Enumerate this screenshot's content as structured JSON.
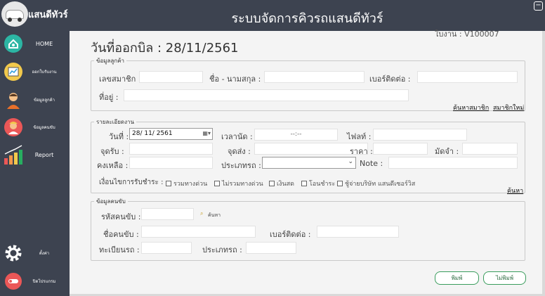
{
  "brand": {
    "name": "แสนดีทัวร์"
  },
  "nav": {
    "home": "HOME",
    "billing": "ออกใบรับงาน",
    "customer": "ข้อมูลลูกค้า",
    "driver": "ข้อมูลคนขับ",
    "report": "Report",
    "settings": "ตั้งค่า",
    "exit": "ปิดโปรแกรม"
  },
  "header": {
    "title": "ระบบจัดการคิวรถแสนดีทัวร์",
    "minimize": "−"
  },
  "page": {
    "bill_date_label": "วันที่ออกบิล : 28/11/2561",
    "job_no": "ใบงาน :   V100007"
  },
  "customer_section": {
    "legend": "ข้อมูลลูกค้า",
    "member_id_label": "เลขสมาชิก :",
    "name_label": "ชื่อ - นามสกุล :",
    "phone_label": "เบอร์ติดต่อ :",
    "address_label": "ที่อยู่ :",
    "search_member_link": "ค้นหาสมาชิก",
    "new_member_link": "สมาชิกใหม่"
  },
  "job_section": {
    "legend": "รายละเอียดงาน",
    "date_label": "วันที่ :",
    "date_value": "28/ 11/  2561",
    "appointment_label": "เวลานัด :",
    "appointment_value": "--:--",
    "flight_label": "ไฟลท์ :",
    "pickup_label": "จุดรับ :",
    "dropoff_label": "จุดส่ง :",
    "price_label": "ราคา :",
    "deposit_label": "มัดจำ :",
    "remaining_label": "คงเหลือ :",
    "car_type_label": "ประเภทรถ :",
    "note_label": "Note :",
    "payment_label": "เงื่อนไขการรับชำระ :",
    "payment_options": [
      "รวมทางด่วน",
      "ไม่รวมทางด่วน",
      "เงินสด",
      "โอนชำระ",
      "ชู้จ่ายบริษัท แสนดีเซอร์วิส"
    ],
    "search_link": "ค้นหา"
  },
  "driver_section": {
    "legend": "ข้อมูลคนขับ",
    "driver_id_label": "รหัสคนขับ :",
    "search_label": "ค้นหา",
    "driver_name_label": "ชื่อคนขับ :",
    "phone_label": "เบอร์ติดต่อ :",
    "plate_label": "ทะเบียนรถ :",
    "car_type_label": "ประเภทรถ :"
  },
  "actions": {
    "print": "พิมพ์",
    "no_print": "ไม่พิมพ์"
  },
  "colors": {
    "sidebar": "#3d4350",
    "accent": "#3a9d5d",
    "background": "#f4f4f4"
  }
}
